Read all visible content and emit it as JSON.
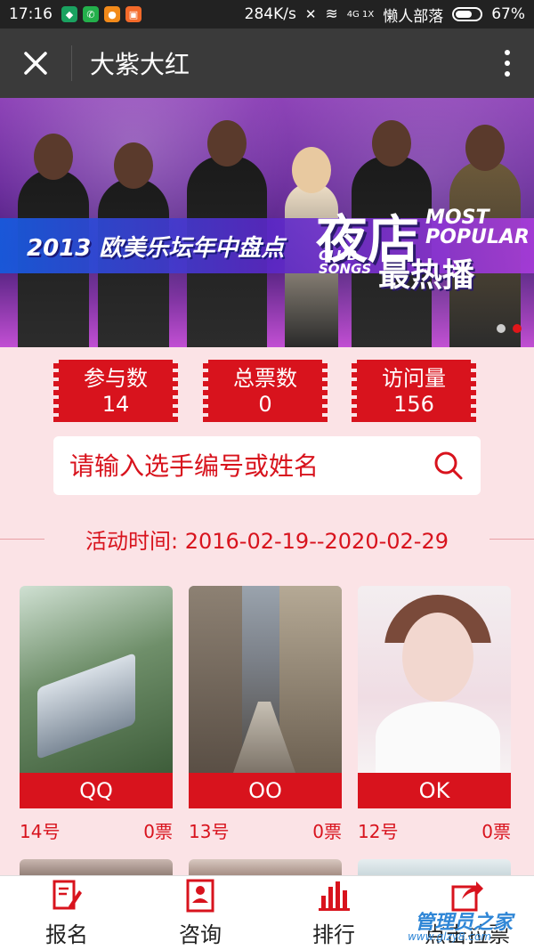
{
  "status_bar": {
    "time": "17:16",
    "net_speed": "284K/s",
    "signal": "4G 1X",
    "carrier": "懒人部落",
    "battery": "67%"
  },
  "app_bar": {
    "title": "大紫大红"
  },
  "banner": {
    "title": "2013 欧美乐坛年中盘点",
    "big_text": "夜店",
    "most_popular": "MOST POPULAR",
    "club_songs": "CLUB SONGS",
    "hot_text": "最热播",
    "slides": 2,
    "active_slide": 2
  },
  "stats": [
    {
      "label": "参与数",
      "value": "14"
    },
    {
      "label": "总票数",
      "value": "0"
    },
    {
      "label": "访问量",
      "value": "156"
    }
  ],
  "search": {
    "placeholder": "请输入选手编号或姓名"
  },
  "activity": {
    "text": "活动时间: 2016-02-19--2020-02-29"
  },
  "entries": [
    {
      "name": "QQ",
      "number": "14号",
      "votes": "0票"
    },
    {
      "name": "OO",
      "number": "13号",
      "votes": "0票"
    },
    {
      "name": "OK",
      "number": "12号",
      "votes": "0票"
    }
  ],
  "bottom_nav": [
    {
      "label": "报名",
      "icon": "signup-icon"
    },
    {
      "label": "咨询",
      "icon": "profile-card-icon"
    },
    {
      "label": "排行",
      "icon": "bar-chart-icon"
    },
    {
      "label": "点击拉票",
      "icon": "share-icon"
    }
  ],
  "watermark": {
    "text": "管理员之家",
    "sub": "www.glzy8.com"
  },
  "colors": {
    "accent": "#d8131d",
    "background": "#fbe3e6",
    "app_bar": "#3a3a3a"
  }
}
